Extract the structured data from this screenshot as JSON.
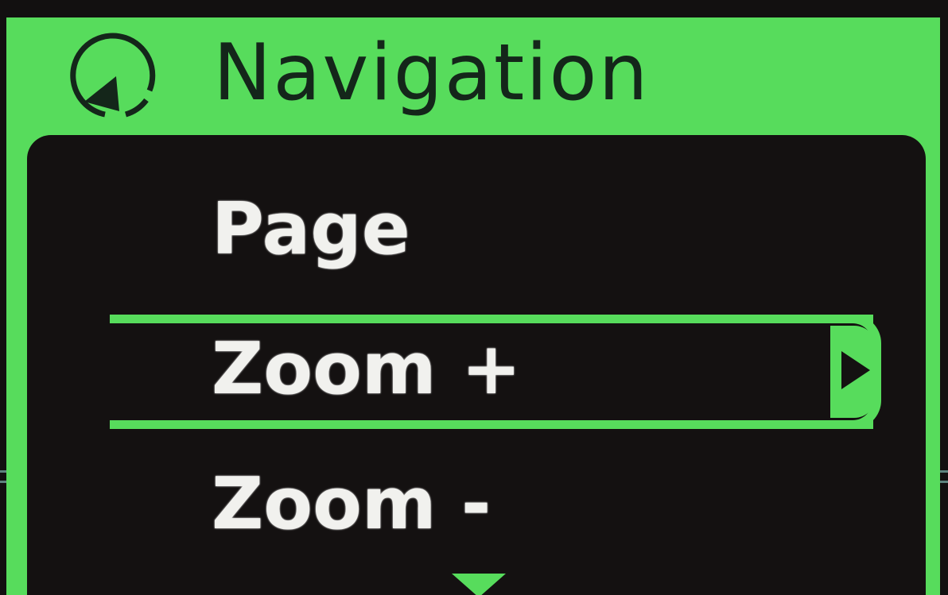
{
  "header": {
    "title": "Navigation",
    "icon": "navigation-compass-icon"
  },
  "menu": {
    "items": [
      {
        "label": "Page",
        "selected": false
      },
      {
        "label": "Zoom +",
        "selected": true
      },
      {
        "label": "Zoom -",
        "selected": false
      }
    ],
    "selected_indicator_icon": "chevron-right-icon",
    "more_indicator_icon": "chevron-down-icon"
  },
  "colors": {
    "accent": "#57dc5c",
    "background": "#141111",
    "text": "#f1f1ee",
    "header_text": "#14261a"
  }
}
